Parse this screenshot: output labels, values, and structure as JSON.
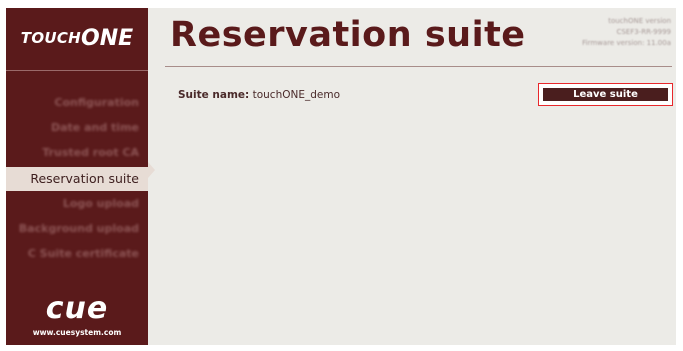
{
  "brand": {
    "prefix": "TOUCH",
    "suffix": "ONE"
  },
  "sidebar": {
    "items": [
      {
        "label": "Configuration"
      },
      {
        "label": "Date and time"
      },
      {
        "label": "Trusted root CA"
      },
      {
        "label": "Reservation suite"
      },
      {
        "label": "Logo upload"
      },
      {
        "label": "Background upload"
      },
      {
        "label": "C Suite certificate"
      }
    ],
    "active_index": 3,
    "footer_logo": "cue",
    "footer_url": "www.cuesystem.com"
  },
  "header": {
    "title": "Reservation suite",
    "version_lines": [
      "touchONE version",
      "CSEF3-RR-9999",
      "Firmware version: 11.00a"
    ]
  },
  "main": {
    "suite_label": "Suite name:",
    "suite_value": "touchONE_demo",
    "leave_button": "Leave suite"
  },
  "colors": {
    "sidebar_bg": "#5a1a1b",
    "title": "#5a1a1b",
    "content_bg": "#ecebe7",
    "button_bg": "#4a1e1e",
    "highlight_border": "#e8272b"
  }
}
